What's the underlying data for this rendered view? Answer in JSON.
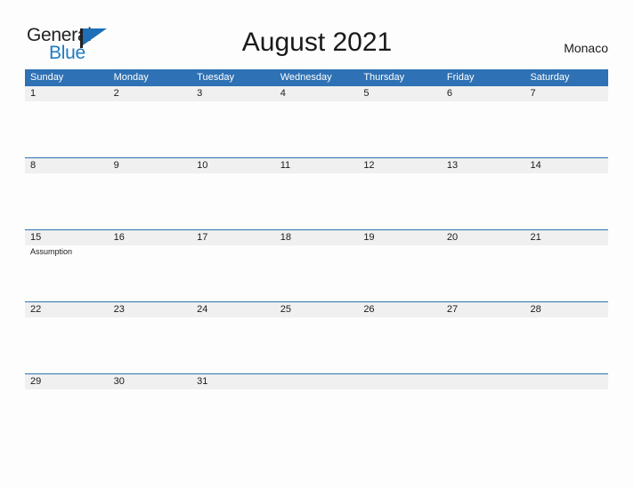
{
  "brand": {
    "name_part1": "General",
    "name_part2": "Blue",
    "logo_icon": "flag-triangle-icon"
  },
  "header": {
    "title": "August 2021",
    "month": "August",
    "year": "2021",
    "region": "Monaco"
  },
  "calendar": {
    "weekday_headers": [
      "Sunday",
      "Monday",
      "Tuesday",
      "Wednesday",
      "Thursday",
      "Friday",
      "Saturday"
    ],
    "accent_color": "#2e71b4",
    "band_color": "#f0f0f0",
    "weeks": [
      [
        {
          "num": "1",
          "event": ""
        },
        {
          "num": "2",
          "event": ""
        },
        {
          "num": "3",
          "event": ""
        },
        {
          "num": "4",
          "event": ""
        },
        {
          "num": "5",
          "event": ""
        },
        {
          "num": "6",
          "event": ""
        },
        {
          "num": "7",
          "event": ""
        }
      ],
      [
        {
          "num": "8",
          "event": ""
        },
        {
          "num": "9",
          "event": ""
        },
        {
          "num": "10",
          "event": ""
        },
        {
          "num": "11",
          "event": ""
        },
        {
          "num": "12",
          "event": ""
        },
        {
          "num": "13",
          "event": ""
        },
        {
          "num": "14",
          "event": ""
        }
      ],
      [
        {
          "num": "15",
          "event": "Assumption"
        },
        {
          "num": "16",
          "event": ""
        },
        {
          "num": "17",
          "event": ""
        },
        {
          "num": "18",
          "event": ""
        },
        {
          "num": "19",
          "event": ""
        },
        {
          "num": "20",
          "event": ""
        },
        {
          "num": "21",
          "event": ""
        }
      ],
      [
        {
          "num": "22",
          "event": ""
        },
        {
          "num": "23",
          "event": ""
        },
        {
          "num": "24",
          "event": ""
        },
        {
          "num": "25",
          "event": ""
        },
        {
          "num": "26",
          "event": ""
        },
        {
          "num": "27",
          "event": ""
        },
        {
          "num": "28",
          "event": ""
        }
      ],
      [
        {
          "num": "29",
          "event": ""
        },
        {
          "num": "30",
          "event": ""
        },
        {
          "num": "31",
          "event": ""
        },
        {
          "num": "",
          "event": ""
        },
        {
          "num": "",
          "event": ""
        },
        {
          "num": "",
          "event": ""
        },
        {
          "num": "",
          "event": ""
        }
      ]
    ]
  }
}
